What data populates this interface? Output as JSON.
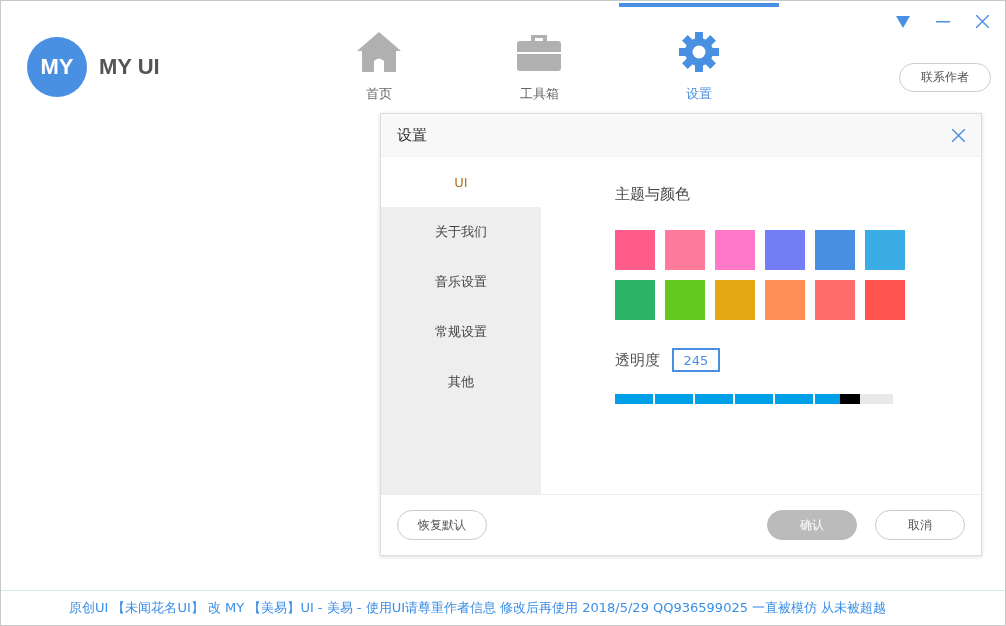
{
  "app": {
    "logo": "MY",
    "title": "MY UI"
  },
  "nav": [
    {
      "label": "首页",
      "kind": "home",
      "selected": false
    },
    {
      "label": "工具箱",
      "kind": "toolbox",
      "selected": false
    },
    {
      "label": "设置",
      "kind": "settings",
      "selected": true
    }
  ],
  "contact_button": "联系作者",
  "dialog": {
    "title": "设置",
    "menu": [
      {
        "label": "UI",
        "selected": true
      },
      {
        "label": "关于我们",
        "selected": false
      },
      {
        "label": "音乐设置",
        "selected": false
      },
      {
        "label": "常规设置",
        "selected": false
      },
      {
        "label": "其他",
        "selected": false
      }
    ],
    "theme_heading": "主题与颜色",
    "swatches": [
      {
        "color": "#ff5c8a"
      },
      {
        "color": "#fe7b9c"
      },
      {
        "color": "#ff79c8"
      },
      {
        "color": "#737ef6"
      },
      {
        "color": "#4a90e2"
      },
      {
        "color": "#3aade6"
      },
      {
        "color": "#2bb467"
      },
      {
        "color": "#65c81e"
      },
      {
        "color": "#e3a813"
      },
      {
        "color": "#ff8f56"
      },
      {
        "color": "#ff6d6a"
      },
      {
        "color": "#ff534f"
      }
    ],
    "opacity_label": "透明度",
    "opacity_value": "245",
    "opacity": {
      "level": 0.88
    },
    "buttons": {
      "reset": "恢复默认",
      "ok": "确认",
      "cancel": "取消"
    }
  },
  "footer": "原创UI 【未闻花名UI】 改 MY 【美易】UI - 美易 - 使用UI请尊重作者信息 修改后再使用  2018/5/29 QQ936599025 一直被模仿 从未被超越"
}
